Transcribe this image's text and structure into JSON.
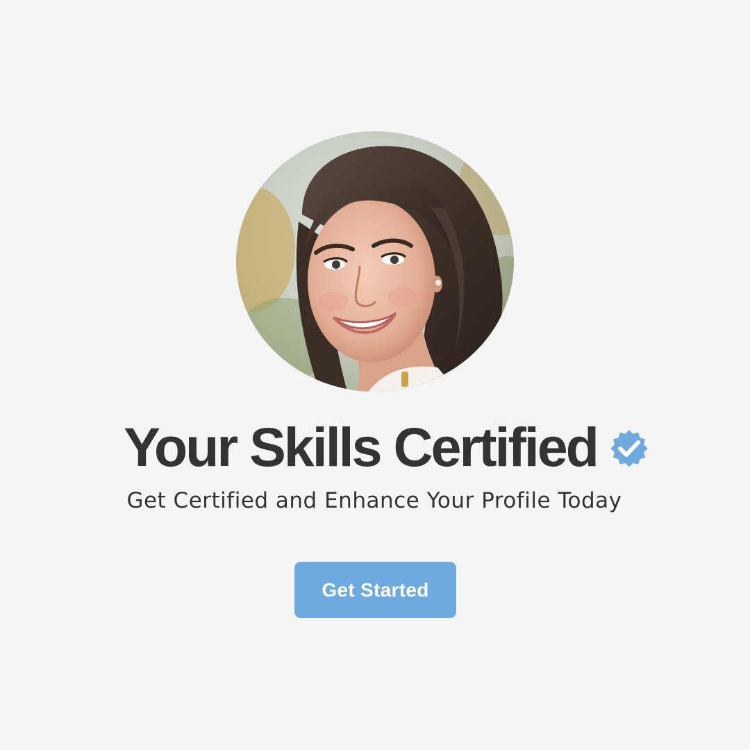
{
  "hero": {
    "avatar_alt": "Smiling woman with long brown hair",
    "title": "Your Skills Certified",
    "badge_icon": "verified-check-icon",
    "subtitle": "Get Certified and Enhance Your Profile Today",
    "cta_label": "Get Started"
  },
  "colors": {
    "background": "#f5f5f5",
    "text": "#333333",
    "accent": "#6eaae0",
    "button_text": "#ffffff"
  }
}
